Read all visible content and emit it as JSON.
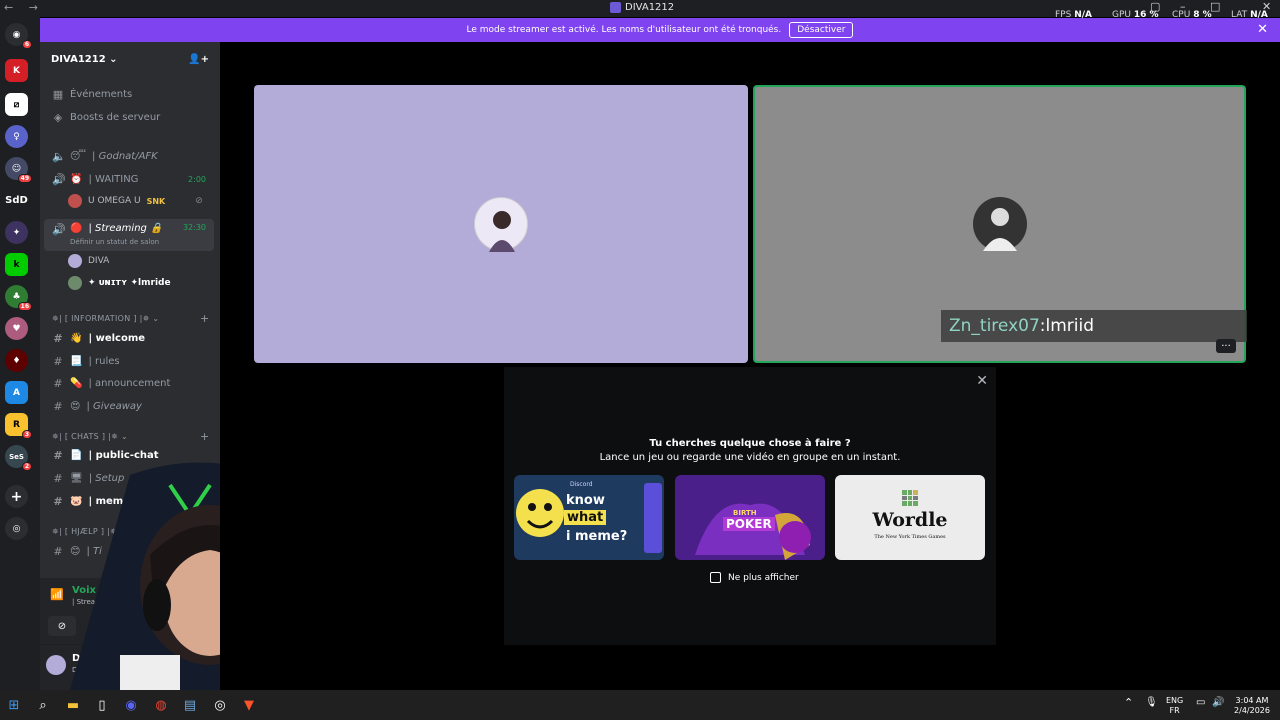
{
  "titlebar": {
    "title": "DIVA1212",
    "perf": {
      "fps_label": "FPS",
      "fps_value": "N/A",
      "gpu_label": "GPU",
      "gpu_value": "16 %",
      "cpu_label": "CPU",
      "cpu_value": "8 %",
      "lat_label": "LAT",
      "lat_value": "N/A"
    }
  },
  "banner": {
    "text": "Le mode streamer est activé. Les noms d'utilisateur ont été tronqués.",
    "button": "Désactiver"
  },
  "server": {
    "name": "DIVA1212",
    "links": [
      "Événements",
      "Boosts de serveur"
    ]
  },
  "voice_channels": [
    {
      "name": "Godnat/AFK",
      "emoji": "😴"
    },
    {
      "name": "WAITING",
      "emoji": "⏰",
      "time": "2:00"
    },
    {
      "name": "Streaming",
      "emoji": "🔴",
      "time": "32:30",
      "status": "Définir un statut de salon"
    }
  ],
  "voice_users": {
    "waiting": "ᑌ OMEGA ᑌ",
    "waiting_tag": "SNK",
    "streaming": [
      "DIVA",
      "✦ ᴜɴɪᴛʏ ✦lmride"
    ]
  },
  "categories": {
    "information": "✵| [ INFORMATION ] |✵",
    "chats": "✵| [ CHATS ] |✵",
    "hjaelp": "✵| [ HJÆLP ] |✵"
  },
  "text_channels": [
    {
      "name": "welcome",
      "emoji": "👋",
      "bold": true
    },
    {
      "name": "rules",
      "emoji": "📃",
      "bold": false
    },
    {
      "name": "announcement",
      "emoji": "💊",
      "bold": false
    },
    {
      "name": "Giveaway",
      "emoji": "😍",
      "bold": false
    },
    {
      "name": "public-chat",
      "emoji": "📄",
      "bold": true
    },
    {
      "name": "Setup",
      "emoji": "🖥",
      "bold": false
    },
    {
      "name": "memes",
      "emoji": "🐷",
      "bold": true
    },
    {
      "name": "Ti",
      "emoji": "😊",
      "bold": false
    }
  ],
  "voice_status": {
    "label": "Voix con",
    "channel": "| Strea"
  },
  "user_panel": {
    "name": "DIVA",
    "status": "Dans un"
  },
  "stream_tile": {
    "name_user": "Zn_tirex07",
    "name_sep": " : ",
    "name_target": "lmriid"
  },
  "activity": {
    "title": "Tu cherches quelque chose à faire ?",
    "subtitle": "Lance un jeu ou regarde une vidéo en groupe en un instant.",
    "cards": [
      {
        "brand": "Discord",
        "w1": "know",
        "w2": "what",
        "w3": "i meme?"
      },
      {
        "w1": "BIRTH",
        "w2": "POKER"
      },
      {
        "w1": "Wordle",
        "w2": "The New York Times Games"
      }
    ],
    "checkbox": "Ne plus afficher"
  },
  "taskbar": {
    "lang": "ENG",
    "region": "FR",
    "time": "3:04 AM",
    "date": "2/4/2026"
  },
  "colors": {
    "banner": "#7f43f0",
    "tile_left": "#b3acd9",
    "tile_right": "#8c8c8c",
    "speaking_green": "#23a55a"
  }
}
